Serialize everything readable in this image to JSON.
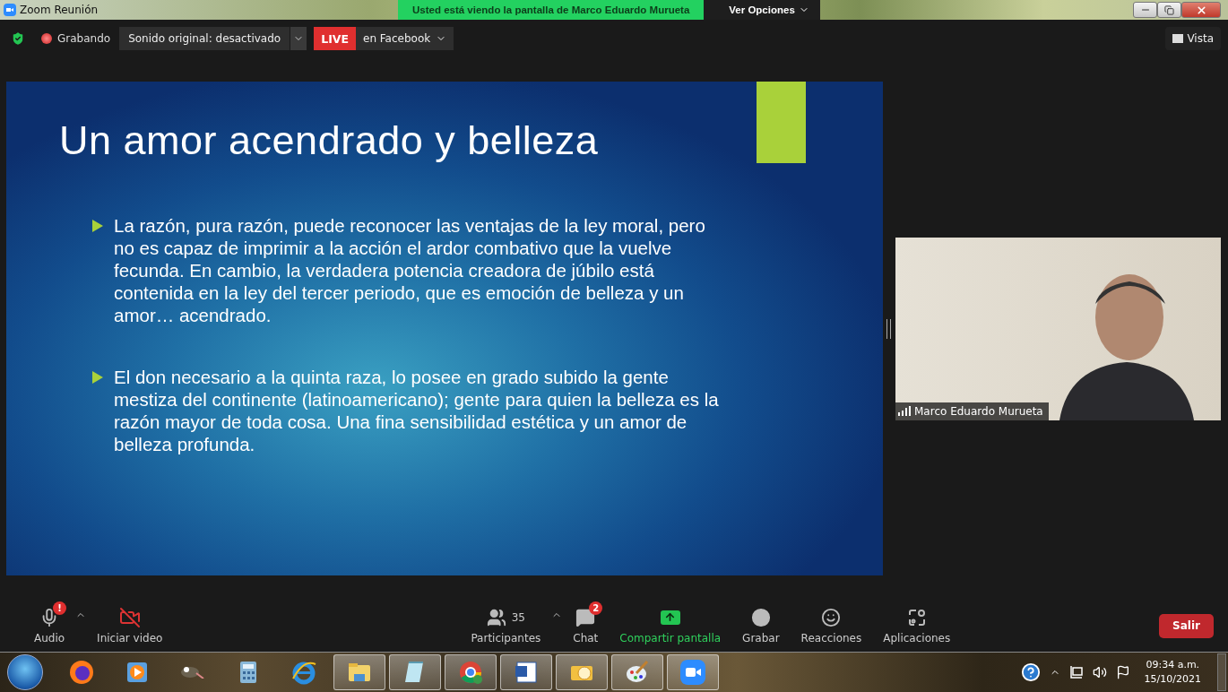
{
  "window": {
    "title": "Zoom Reunión"
  },
  "share_banner": {
    "text": "Usted está viendo la pantalla de Marco Eduardo Murueta",
    "options": "Ver Opciones"
  },
  "top_bar": {
    "recording": "Grabando",
    "sound": "Sonido original: desactivado",
    "live": "LIVE",
    "live_target": "en Facebook",
    "view": "Vista"
  },
  "slide": {
    "title": "Un amor acendrado y belleza",
    "bullets": [
      "La razón, pura razón, puede reconocer las ventajas de la ley moral, pero no es capaz de imprimir a la acción el ardor combativo que la vuelve fecunda. En cambio, la verdadera potencia creadora de júbilo está contenida en la ley del tercer periodo, que es emoción de belleza y un amor… acendrado.",
      "El don necesario a la quinta raza, lo posee en grado subido la gente mestiza del continente (latinoamericano); gente para quien la belleza es la razón mayor de toda cosa. Una fina sensibilidad estética y un amor de belleza profunda."
    ]
  },
  "video": {
    "name": "Marco Eduardo Murueta"
  },
  "toolbar": {
    "left": [
      {
        "kind": "audio",
        "label": "Audio",
        "badge": "!"
      },
      {
        "kind": "video",
        "label": "Iniciar video",
        "muted": true
      }
    ],
    "center": [
      {
        "kind": "participants",
        "label": "Participantes",
        "count": "35"
      },
      {
        "kind": "chat",
        "label": "Chat",
        "badge": "2"
      },
      {
        "kind": "share",
        "label": "Compartir pantalla"
      },
      {
        "kind": "record",
        "label": "Grabar"
      },
      {
        "kind": "reactions",
        "label": "Reacciones"
      },
      {
        "kind": "apps",
        "label": "Aplicaciones"
      }
    ],
    "leave": "Salir"
  },
  "taskbar": {
    "apps": [
      {
        "kind": "firefox",
        "open": false
      },
      {
        "kind": "media",
        "open": false
      },
      {
        "kind": "gimp",
        "open": false
      },
      {
        "kind": "calculator",
        "open": false
      },
      {
        "kind": "ie",
        "open": false
      },
      {
        "kind": "explorer",
        "open": true
      },
      {
        "kind": "notepad",
        "open": true
      },
      {
        "kind": "chrome",
        "open": true
      },
      {
        "kind": "word",
        "open": true
      },
      {
        "kind": "outlook",
        "open": true
      },
      {
        "kind": "paint",
        "open": true
      },
      {
        "kind": "zoom",
        "open": true
      }
    ],
    "time": "09:34 a.m.",
    "date": "15/10/2021"
  }
}
